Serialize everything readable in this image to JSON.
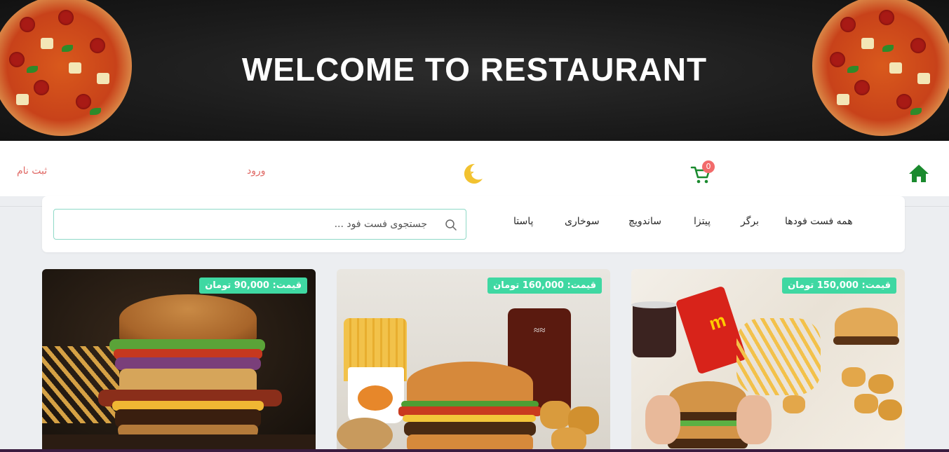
{
  "banner": {
    "title": "WELCOME TO RESTAURANT"
  },
  "nav": {
    "cart_count": "0",
    "login_label": "ورود",
    "register_label": "ثبت نام"
  },
  "filters": {
    "categories": [
      "همه فست فودها",
      "برگر",
      "پیتزا",
      "ساندویچ",
      "سوخاری",
      "پاستا"
    ],
    "search_placeholder": "جستجوی فست فود ..."
  },
  "products": [
    {
      "price_label": "قیمت: 150,000 تومان"
    },
    {
      "price_label": "قیمت: 160,000 تومان"
    },
    {
      "price_label": "قیمت: 90,000 تومان"
    }
  ],
  "colors": {
    "accent_green": "#3fd8a2",
    "link_red": "#e06a66",
    "home_green": "#1a8a2e",
    "badge_red": "#f26b6b"
  }
}
